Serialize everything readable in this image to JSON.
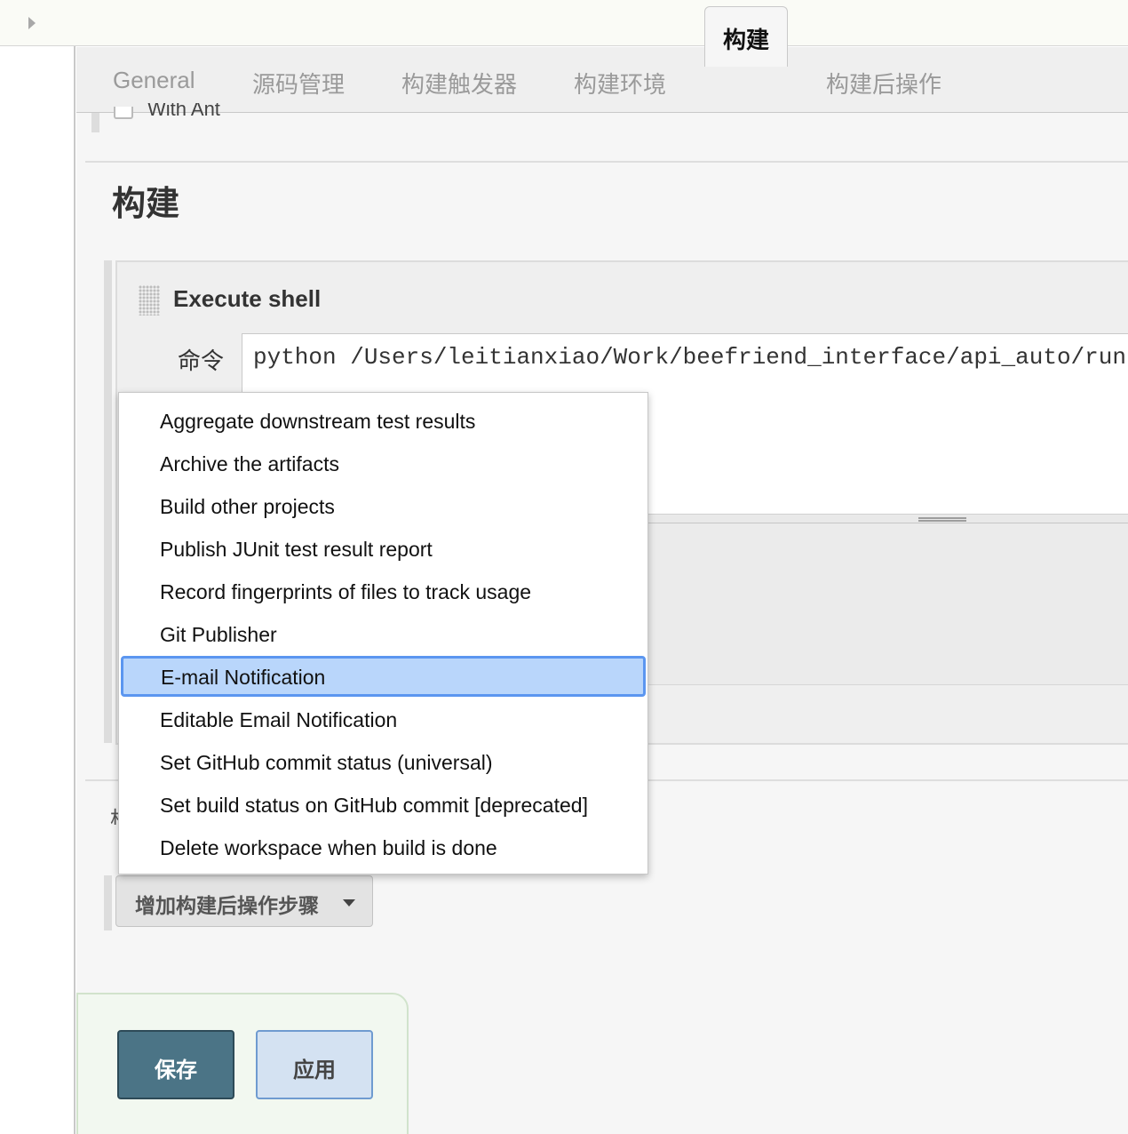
{
  "tabs": {
    "general": "General",
    "scm": "源码管理",
    "triggers": "构建触发器",
    "env": "构建环境",
    "build": "构建",
    "post": "构建后操作"
  },
  "partial_option": "With Ant",
  "section": {
    "title": "构建"
  },
  "step": {
    "title": "Execute shell",
    "command_label": "命令",
    "command_value": "python /Users/leitianxiao/Work/beefriend_interface/api_auto/run"
  },
  "post_build": {
    "add_button": "增加构建后操作步骤"
  },
  "menu": {
    "selected_index": 6,
    "items": [
      "Aggregate downstream test results",
      "Archive the artifacts",
      "Build other projects",
      "Publish JUnit test result report",
      "Record fingerprints of files to track usage",
      "Git Publisher",
      "E-mail Notification",
      "Editable Email Notification",
      "Set GitHub commit status (universal)",
      "Set build status on GitHub commit [deprecated]",
      "Delete workspace when build is done"
    ]
  },
  "footer": {
    "save": "保存",
    "apply": "应用"
  },
  "colors": {
    "save_button": "#4b7486",
    "apply_button": "#d4e2f2",
    "menu_selected": "#b9d6fb",
    "menu_selected_border": "#5b96f0"
  }
}
